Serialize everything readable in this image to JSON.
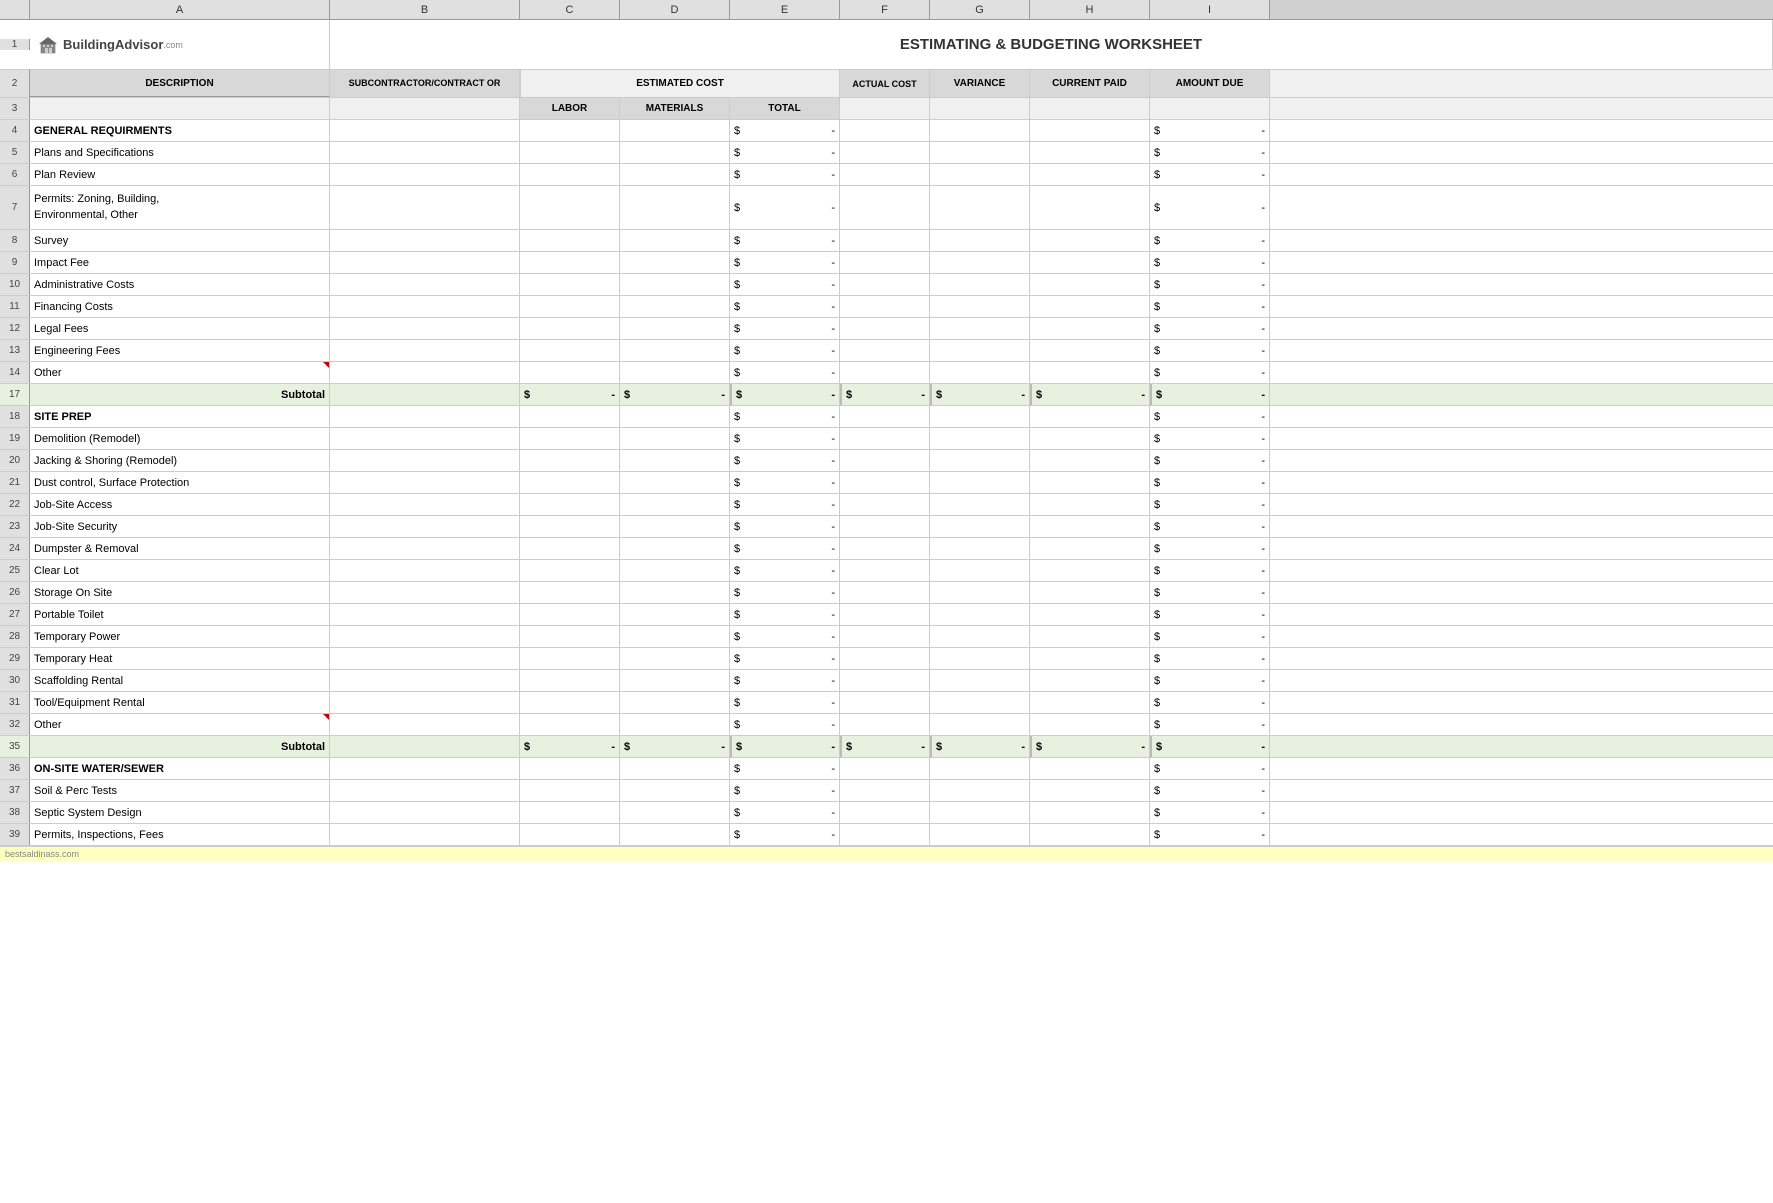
{
  "title": "ESTIMATING & BUDGETING WORKSHEET",
  "logo": {
    "text": "BuildingAdvisor",
    "suffix": ".com"
  },
  "columns": {
    "headers": [
      "A",
      "B",
      "C",
      "D",
      "E",
      "F",
      "G",
      "H",
      "I"
    ]
  },
  "header_row2": {
    "description": "DESCRIPTION",
    "subcontractor": "SUBCONTRACTOR/CONTRACT OR",
    "estimated_cost": "ESTIMATED COST",
    "actual_cost": "ACTUAL COST",
    "variance": "VARIANCE",
    "current_paid": "CURRENT PAID",
    "amount_due": "AMOUNT DUE"
  },
  "header_row3": {
    "labor": "LABOR",
    "materials": "MATERIALS",
    "total": "TOTAL"
  },
  "sections": [
    {
      "id": "general",
      "title_row": 4,
      "title": "GENERAL REQUIRMENTS",
      "items": [
        {
          "row": 5,
          "desc": "Plans and Specifications"
        },
        {
          "row": 6,
          "desc": "Plan Review"
        },
        {
          "row": 7,
          "desc": "Permits: Zoning, Building,\nEnvironmental, Other",
          "multiline": true
        },
        {
          "row": 8,
          "desc": "Survey"
        },
        {
          "row": 9,
          "desc": "Impact Fee"
        },
        {
          "row": 10,
          "desc": "Administrative Costs"
        },
        {
          "row": 11,
          "desc": "Financing Costs"
        },
        {
          "row": 12,
          "desc": "Legal Fees"
        },
        {
          "row": 13,
          "desc": "Engineering Fees"
        },
        {
          "row": 14,
          "desc": "Other",
          "marker": true
        }
      ],
      "subtotal_row": 17
    },
    {
      "id": "site_prep",
      "title_row": 18,
      "title": "SITE PREP",
      "items": [
        {
          "row": 19,
          "desc": "Demolition (Remodel)"
        },
        {
          "row": 20,
          "desc": "Jacking & Shoring (Remodel)"
        },
        {
          "row": 21,
          "desc": "Dust control, Surface Protection"
        },
        {
          "row": 22,
          "desc": "Job-Site Access"
        },
        {
          "row": 23,
          "desc": "Job-Site Security"
        },
        {
          "row": 24,
          "desc": "Dumpster & Removal"
        },
        {
          "row": 25,
          "desc": "Clear Lot"
        },
        {
          "row": 26,
          "desc": "Storage On Site"
        },
        {
          "row": 27,
          "desc": "Portable Toilet"
        },
        {
          "row": 28,
          "desc": "Temporary Power"
        },
        {
          "row": 29,
          "desc": "Temporary Heat"
        },
        {
          "row": 30,
          "desc": "Scaffolding Rental"
        },
        {
          "row": 31,
          "desc": "Tool/Equipment Rental"
        },
        {
          "row": 32,
          "desc": "Other",
          "marker": true
        }
      ],
      "subtotal_row": 35
    },
    {
      "id": "water_sewer",
      "title_row": 36,
      "title": "ON-SITE WATER/SEWER",
      "items": [
        {
          "row": 37,
          "desc": "Soil & Perc Tests"
        },
        {
          "row": 38,
          "desc": "Septic System Design"
        },
        {
          "row": 39,
          "desc": "Permits, Inspections, Fees"
        }
      ]
    }
  ],
  "subtotal_label": "Subtotal",
  "dollar_dash": "$ -",
  "dollar_sign": "$",
  "dash": "-",
  "watermark": "bestsaldinass.com"
}
